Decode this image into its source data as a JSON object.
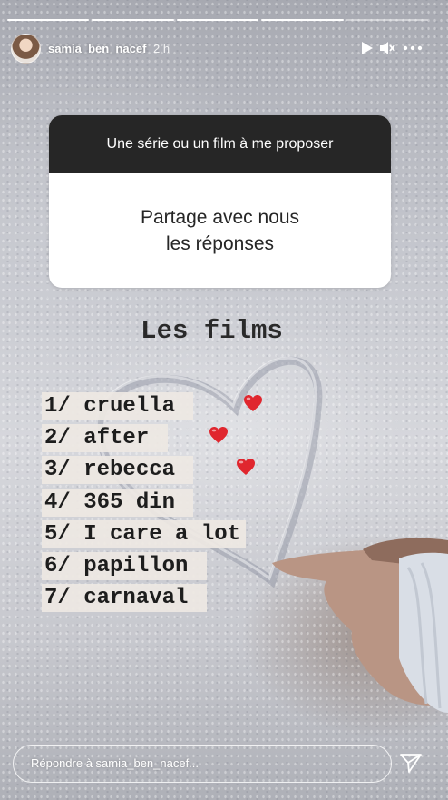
{
  "story": {
    "progress_segments": [
      1,
      1,
      1,
      1,
      0
    ]
  },
  "header": {
    "username": "samia_ben_nacef",
    "time": "2 h",
    "icons": [
      "play-icon",
      "mute-icon",
      "more-icon"
    ]
  },
  "question": {
    "prompt": "Une série ou un film à me proposer",
    "answer": "Partage avec nous\nles réponses"
  },
  "films": {
    "title": "Les films",
    "items": [
      {
        "text": "1/ cruella ",
        "heart": true
      },
      {
        "text": "2/ after ",
        "heart": true
      },
      {
        "text": "3/ rebecca ",
        "heart": true
      },
      {
        "text": "4/ 365 din ",
        "heart": false
      },
      {
        "text": "5/ I care a lot",
        "heart": false
      },
      {
        "text": "6/ papillon ",
        "heart": false
      },
      {
        "text": "7/ carnaval ",
        "heart": false
      }
    ]
  },
  "reply": {
    "placeholder": "Répondre à samia_ben_nacef...",
    "send_icon": "send-icon"
  },
  "colors": {
    "heart": "#e0262e",
    "card_dark": "#262626"
  }
}
